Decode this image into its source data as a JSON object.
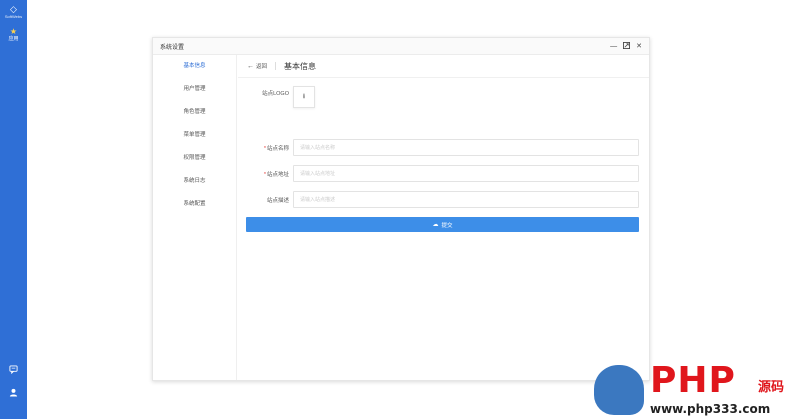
{
  "rail": {
    "brand_text": "SoftWebs",
    "app_label": "应用",
    "bottom_icons": [
      "chat-icon",
      "user-icon"
    ],
    "color": "#2f6fd6"
  },
  "window": {
    "title": "系统设置",
    "controls": [
      "minimize-icon",
      "maximize-icon",
      "close-icon"
    ]
  },
  "sidebar": {
    "items": [
      {
        "label": "基本信息",
        "active": true
      },
      {
        "label": "用户管理"
      },
      {
        "label": "角色管理"
      },
      {
        "label": "菜单管理"
      },
      {
        "label": "权限管理"
      },
      {
        "label": "系统日志"
      },
      {
        "label": "系统配置"
      }
    ]
  },
  "header": {
    "back_label": "返回",
    "page_title": "基本信息"
  },
  "form": {
    "logo_label": "站点LOGO",
    "name_label": "站点名称",
    "name_placeholder": "请输入站点名称",
    "address_label": "站点地址",
    "address_placeholder": "请输入站点地址",
    "desc_label": "站点描述",
    "desc_placeholder": "请输入站点描述",
    "required_mark": "*",
    "submit_label": "提交"
  },
  "watermark": {
    "php": "PHP",
    "yuanma": "源码",
    "url": "www.php333.com"
  },
  "colors": {
    "accent": "#3d8ee8",
    "rail": "#2f6fd6",
    "watermark_red": "#e0161c"
  }
}
